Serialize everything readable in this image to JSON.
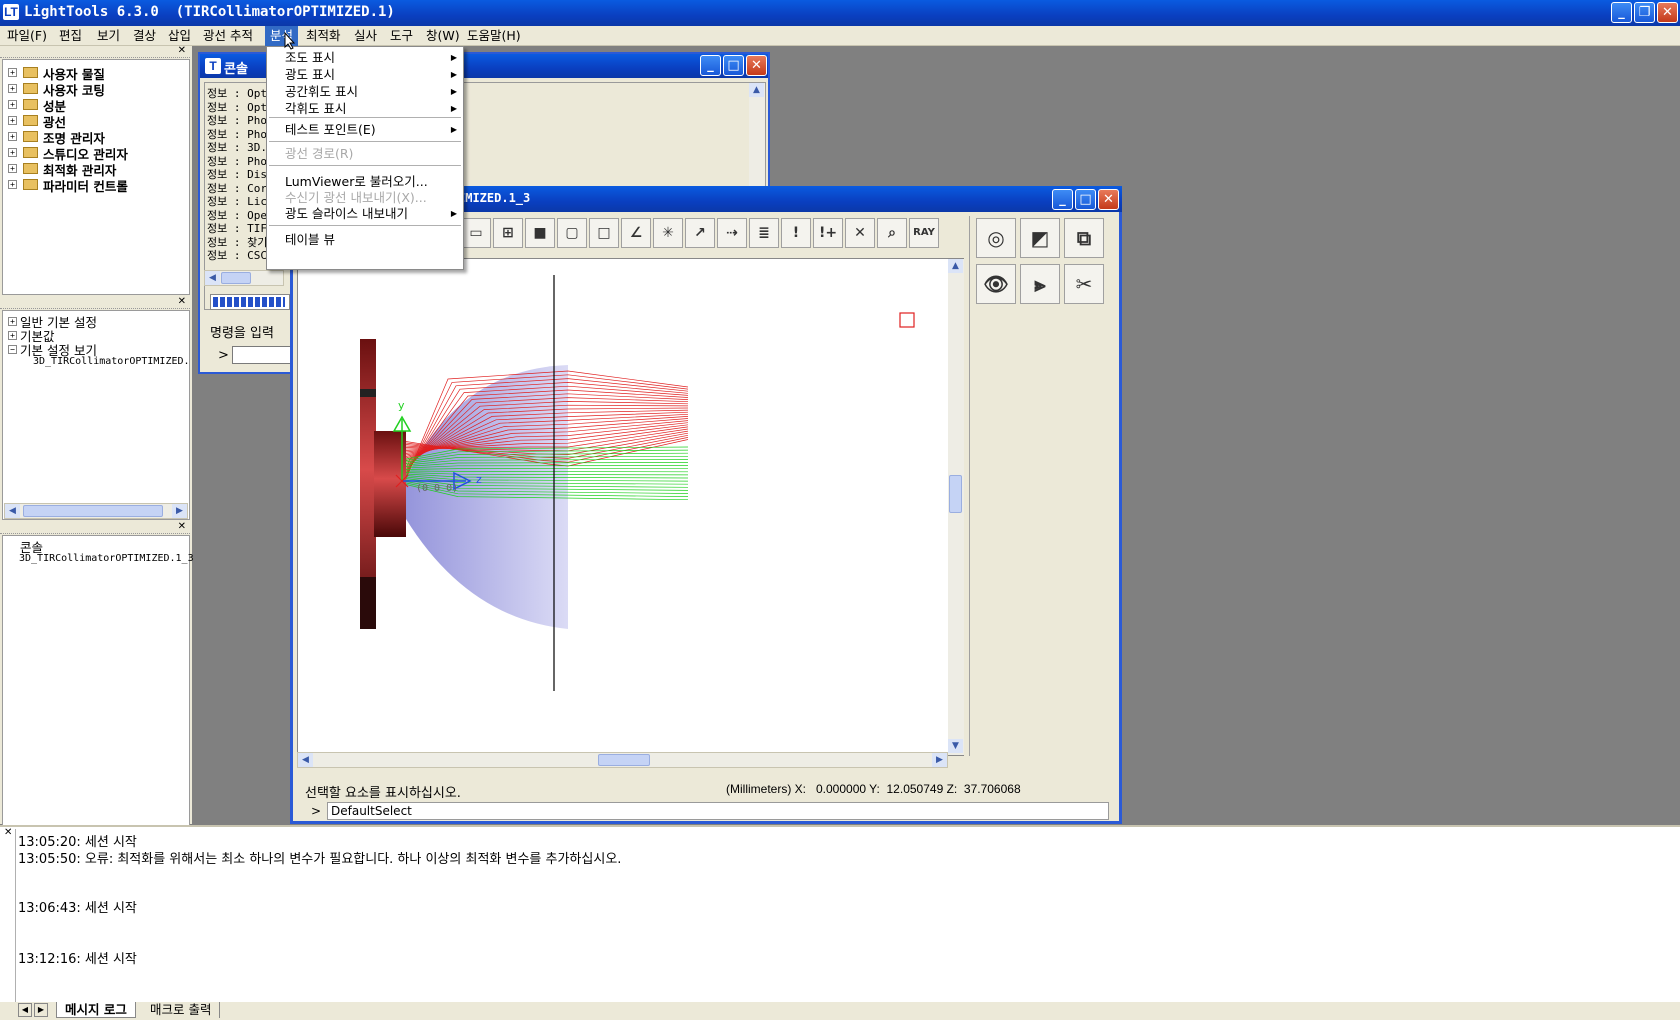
{
  "app": {
    "title": "LightTools 6.3.0  (TIRCollimatorOPTIMIZED.1)",
    "icon": "LT"
  },
  "menubar": [
    {
      "label": "파일(F)",
      "active": false
    },
    {
      "label": "편집",
      "active": false
    },
    {
      "label": "보기",
      "active": false
    },
    {
      "label": "결상",
      "active": false
    },
    {
      "label": "삽입",
      "active": false
    },
    {
      "label": "광선 추적",
      "active": false
    },
    {
      "label": "분석",
      "active": true
    },
    {
      "label": "최적화",
      "active": false
    },
    {
      "label": "실사",
      "active": false
    },
    {
      "label": "도구",
      "active": false
    },
    {
      "label": "창(W)",
      "active": false
    },
    {
      "label": "도움말(H)",
      "active": false
    }
  ],
  "tree1": [
    "사용자 물질",
    "사용자 코팅",
    "성분",
    "광선",
    "조명 관리자",
    "스튜디오 관리자",
    "최적화 관리자",
    "파라미터 컨트롤"
  ],
  "tree2": {
    "items": [
      "일반 기본 설정",
      "기본값",
      "기본 설정 보기"
    ],
    "child": "3D_TIRCollimatorOPTIMIZED."
  },
  "tree3": {
    "root": "콘솔",
    "child": "3D_TIRCollimatorOPTIMIZED.1_3"
  },
  "analysis_menu": {
    "items": [
      {
        "label": "조도 표시",
        "sub": true,
        "disabled": false
      },
      {
        "label": "광도 표시",
        "sub": true,
        "disabled": false
      },
      {
        "label": "공간휘도 표시",
        "sub": true,
        "disabled": false
      },
      {
        "label": "각휘도 표시",
        "sub": true,
        "disabled": false
      },
      {
        "label": "테스트 포인트(E)",
        "sub": true,
        "disabled": false
      },
      {
        "label": "광선 경로(R)",
        "sub": false,
        "disabled": true
      },
      {
        "label": "LumViewer로 불러오기...",
        "sub": false,
        "disabled": false
      },
      {
        "label": "수신기 광선 내보내기(X)...",
        "sub": false,
        "disabled": true
      },
      {
        "label": "광도 슬라이스 내보내기",
        "sub": true,
        "disabled": false
      },
      {
        "label": "테이블 뷰",
        "sub": false,
        "disabled": false
      }
    ],
    "submenu_arrow": "▶"
  },
  "console_window": {
    "title": "콘솔",
    "prefix": "정보 :",
    "lines": [
      "Opt",
      "Opt",
      "Pho",
      "Pho",
      "3D.",
      "Pho",
      "Dis",
      "Cor",
      "Lic",
      "Ope",
      "TIF",
      "찾기",
      "CSC"
    ],
    "prompt_label": "명령을 입력",
    "prompt_symbol": ">"
  },
  "view_window": {
    "title": "IMIZED.1_3",
    "toolbar_icons": [
      "frame",
      "grid",
      "solid-cube",
      "wire-cube",
      "cube-outline",
      "axis",
      "triad",
      "arrow",
      "lens-ray",
      "report",
      "warning",
      "warning-plus",
      "cross",
      "zoom",
      "RAY"
    ],
    "ray_label": "RAY",
    "status_text": "선택할 요소를 표시하십시오.",
    "coord_readout": "(Millimeters) X:   0.000000 Y:  12.050749 Z:  37.706068",
    "command_prompt": ">",
    "command_value": "DefaultSelect",
    "axis_y_label": "y",
    "axis_z_label": "z",
    "origin_label": "(0 0 0)"
  },
  "side_tool_icons": [
    "lens",
    "surface-edit",
    "solid-group",
    "eye",
    "lens-rays",
    "scissors"
  ],
  "log": [
    {
      "time": "13:05:20:",
      "text": "세션 시작"
    },
    {
      "time": "13:05:50:",
      "text": "오류: 최적화를 위해서는 최소 하나의 변수가 필요합니다.  하나 이상의 최적화 변수를 추가하십시오."
    },
    {
      "time": "13:06:43:",
      "text": "세션 시작"
    },
    {
      "time": "13:12:16:",
      "text": "세션 시작"
    }
  ],
  "bottom_tabs": [
    "메시지 로그",
    "매크로 출력"
  ],
  "colors": {
    "title_blue": "#0a3fc0",
    "menu_highlight": "#316ac5",
    "ray_red": "#e02020",
    "ray_green": "#20d020",
    "lens_blue": "#9a9ae0",
    "body_red": "#b02828"
  }
}
